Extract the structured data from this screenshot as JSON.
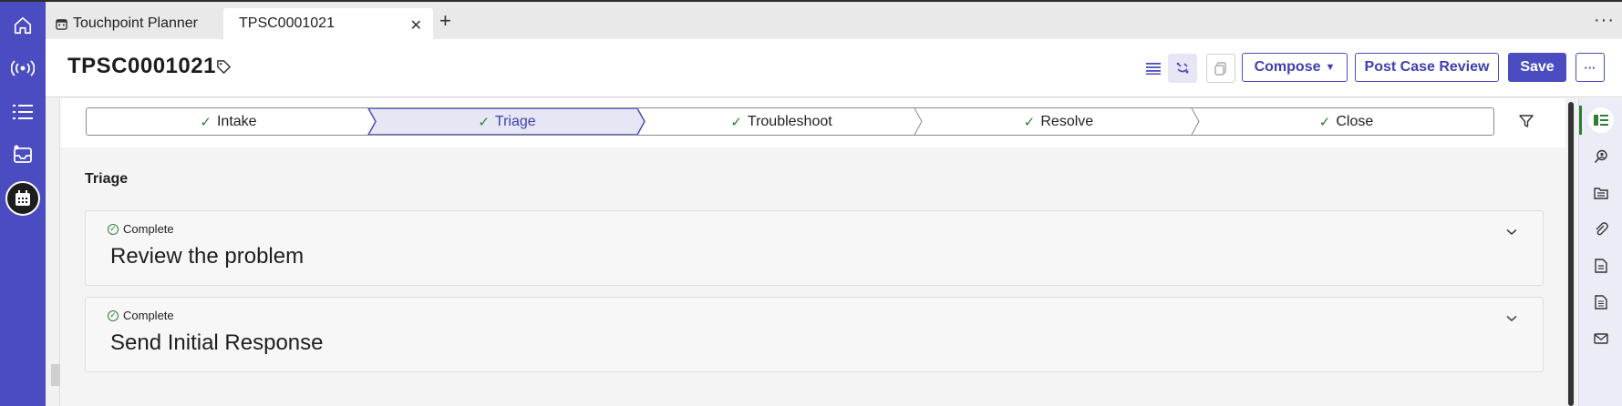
{
  "tabs": [
    {
      "label": "Touchpoint Planner",
      "icon": "calendar-icon"
    },
    {
      "label": "TPSC0001021",
      "close_icon": "close-icon"
    }
  ],
  "tab_add_label": "+",
  "tab_more_label": "···",
  "record": {
    "title": "TPSC0001021"
  },
  "toolbar": {
    "compose_label": "Compose",
    "post_case_review_label": "Post Case Review",
    "save_label": "Save",
    "more_label": "···"
  },
  "stages": [
    {
      "label": "Intake",
      "status": "complete"
    },
    {
      "label": "Triage",
      "status": "complete",
      "selected": true
    },
    {
      "label": "Troubleshoot",
      "status": "complete"
    },
    {
      "label": "Resolve",
      "status": "complete"
    },
    {
      "label": "Close",
      "status": "complete"
    }
  ],
  "section": {
    "title": "Triage"
  },
  "tasks": [
    {
      "status": "Complete",
      "title": "Review the problem"
    },
    {
      "status": "Complete",
      "title": "Send Initial Response"
    }
  ],
  "colors": {
    "accent": "#4b4cc1",
    "selected_stage_bg": "#e6e6f5",
    "check_green": "#2e7d32"
  },
  "left_rail_icons": [
    "home-icon",
    "broadcast-icon",
    "list-icon",
    "inbox-icon",
    "calendar-icon"
  ],
  "right_rail_icons": [
    "checklist-icon",
    "search-person-icon",
    "folder-icon",
    "paperclip-icon",
    "document-icon",
    "report-icon",
    "email-icon"
  ]
}
